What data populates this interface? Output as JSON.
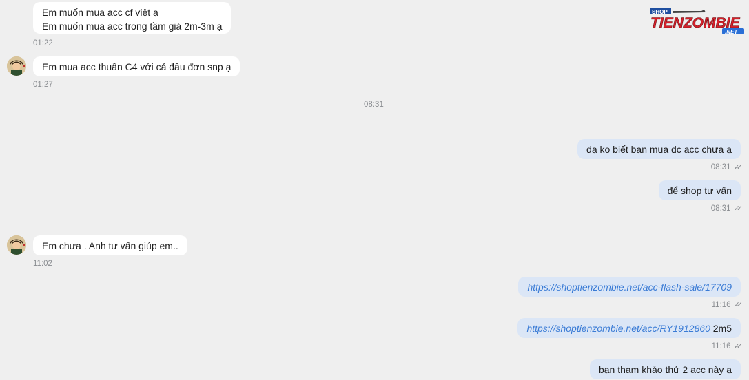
{
  "messages": {
    "m1": {
      "line1": "Em muốn mua acc cf việt ạ",
      "line2": "Em muốn mua acc trong tầm giá 2m-3m ạ",
      "time": "01:22"
    },
    "m2": {
      "text": "Em mua acc thuần C4 với cả đầu đơn snp ạ",
      "time": "01:27"
    },
    "divider_time": "08:31",
    "m3": {
      "text": "dạ ko biết bạn mua dc acc chưa ạ",
      "time": "08:31"
    },
    "m4": {
      "text": "để shop tư vấn",
      "time": "08:31"
    },
    "m5": {
      "text": "Em chưa . Anh tư vấn giúp em..",
      "time": "11:02"
    },
    "m6": {
      "link": "https://shoptienzombie.net/acc-flash-sale/17709",
      "time": "11:16"
    },
    "m7": {
      "link": "https://shoptienzombie.net/acc/RY1912860",
      "suffix": " 2m5",
      "time": "11:16"
    },
    "m8": {
      "text": "bạn tham khảo thử 2 acc này ạ"
    }
  },
  "logo": {
    "top_text": "SHOP",
    "brand_text": "TIENZOMBIE",
    "tld_text": ".NET"
  },
  "icons": {
    "read_receipt": "double-check-icon",
    "avatar": "user-avatar"
  }
}
